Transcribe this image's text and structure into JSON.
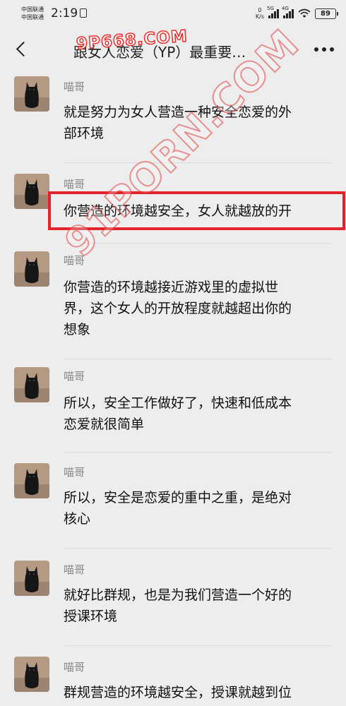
{
  "status_bar": {
    "carrier_1": "中国联通",
    "carrier_2": "中国联通",
    "time": "2:19",
    "net_speed_value": "0",
    "net_speed_unit": "K/s",
    "sig1_label": "5G",
    "sig2_label": "4G",
    "battery": "89"
  },
  "header": {
    "title": "跟女人恋爱（YP）最重要…"
  },
  "watermarks": {
    "top": "9P668.COM",
    "diagonal": "91PORN.COM"
  },
  "messages": [
    {
      "sender": "喵哥",
      "text": "就是努力为女人营造一种安全恋爱的外\n部环境"
    },
    {
      "sender": "喵哥",
      "text": "你营造的环境越安全，女人就越放的开"
    },
    {
      "sender": "喵哥",
      "text": "你营造的环境越接近游戏里的虚拟世\n界，这个女人的开放程度就越超出你的\n想象"
    },
    {
      "sender": "喵哥",
      "text": "所以，安全工作做好了，快速和低成本\n恋爱就很简单"
    },
    {
      "sender": "喵哥",
      "text": "所以，安全是恋爱的重中之重，是绝对\n核心"
    },
    {
      "sender": "喵哥",
      "text": "就好比群规，也是为我们营造一个好的\n授课环境"
    },
    {
      "sender": "喵哥",
      "text": "群规营造的环境越安全，授课就越到位"
    }
  ],
  "colors": {
    "background": "#ededed",
    "highlight_border": "#e3232c",
    "watermark": "#ef2d2d"
  }
}
